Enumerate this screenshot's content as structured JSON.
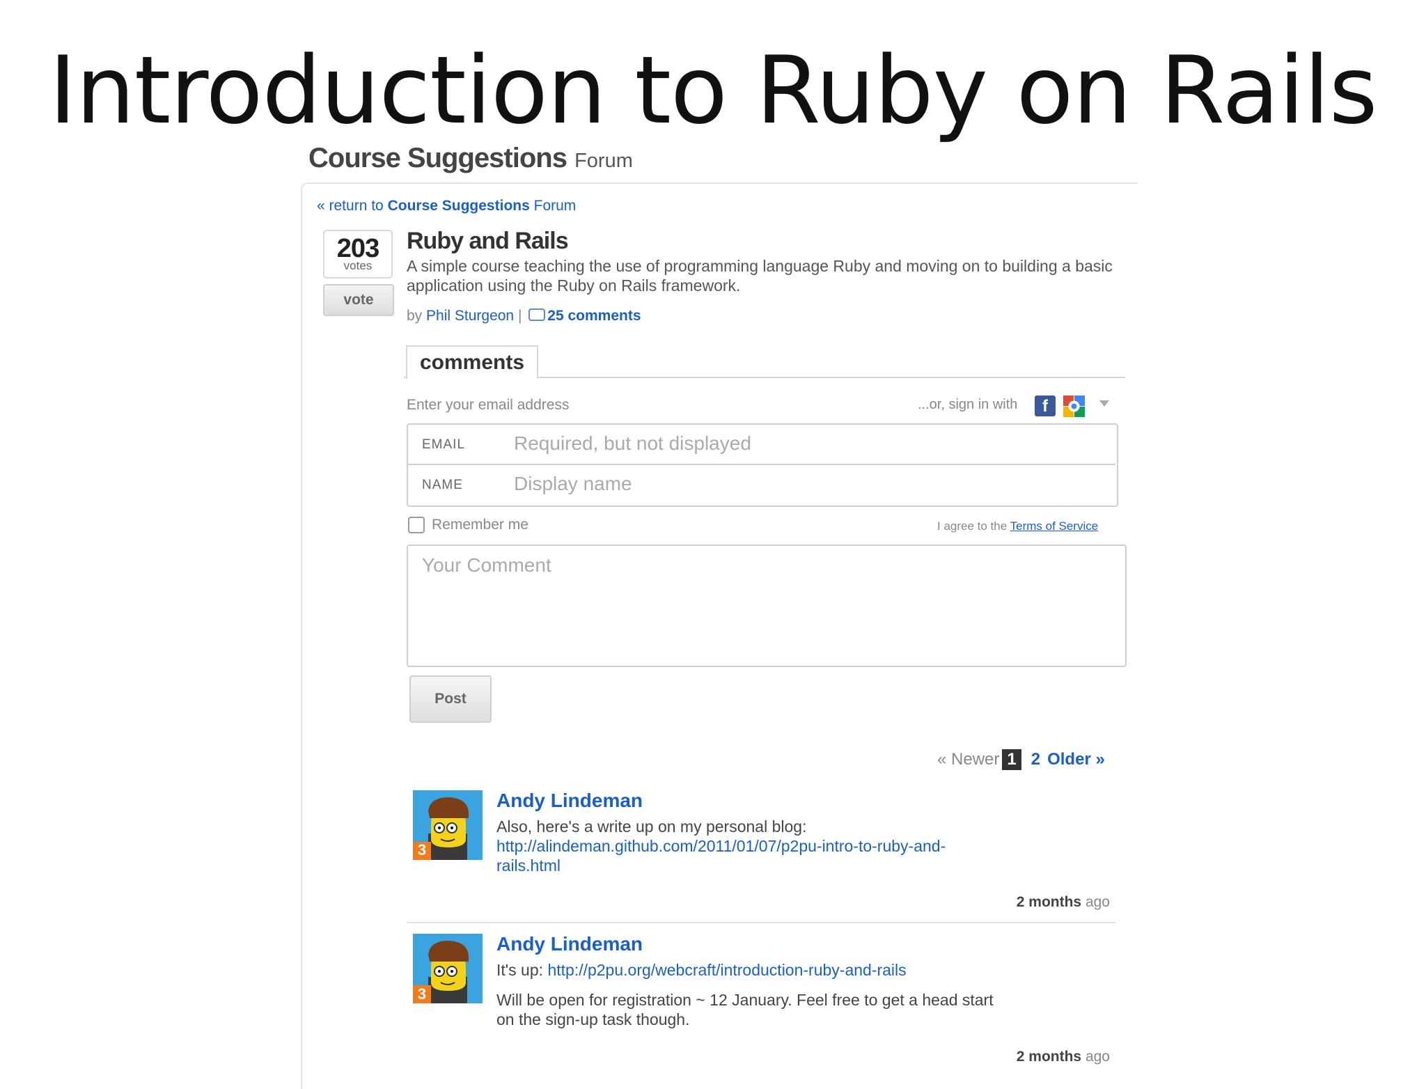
{
  "slide": {
    "title": "Introduction to Ruby on Rails"
  },
  "header": {
    "title_bold": "Course Suggestions",
    "title_suffix": "Forum"
  },
  "back_link": {
    "prefix": "« return to",
    "forum_name": "Course Suggestions",
    "suffix": "Forum"
  },
  "topic": {
    "votes": "203",
    "votes_label": "votes",
    "vote_button": "vote",
    "title": "Ruby and Rails",
    "description": "A simple course teaching the use of programming language Ruby and moving on to building a basic application using the Ruby on Rails framework.",
    "by_label": "by",
    "author": "Phil Sturgeon",
    "separator": "|",
    "comments_count": "25 comments"
  },
  "comments_tab": {
    "label": "comments"
  },
  "form": {
    "email_prompt": "Enter your email address",
    "signin_text": "...or, sign in with",
    "icons": {
      "facebook": "facebook-icon",
      "google": "google-icon",
      "dropdown": "chevron-down-icon"
    },
    "email_label": "EMAIL",
    "email_placeholder": "Required, but not displayed",
    "name_label": "NAME",
    "name_placeholder": "Display name",
    "remember_label": "Remember me",
    "terms_prefix": "I agree to the",
    "terms_link": "Terms of Service",
    "comment_placeholder": "Your Comment",
    "post_button": "Post"
  },
  "pagination": {
    "newer": "« Newer",
    "current": "1",
    "page2": "2",
    "older": "Older »"
  },
  "comments": [
    {
      "author": "Andy Lindeman",
      "badge": "3",
      "text": "Also, here's a write up on my personal blog:",
      "link_line1": "http://alindeman.github.com/2011/01/07/p2pu-intro-to-ruby-and-",
      "link_line2": "rails.html",
      "time_bold": "2 months",
      "time_suffix": "ago"
    },
    {
      "author": "Andy Lindeman",
      "badge": "3",
      "text_prefix": "It's up:",
      "link": "http://p2pu.org/webcraft/introduction-ruby-and-rails",
      "text2_line1": "Will be open for registration ~ 12 January. Feel free to get a head start",
      "text2_line2": "on the sign-up task though.",
      "time_bold": "2 months",
      "time_suffix": "ago"
    }
  ],
  "colors": {
    "link": "#1a5fc8",
    "facebook": "#3b5998",
    "avatar_bg": "#3aa3e0",
    "badge": "#f07c1a"
  }
}
